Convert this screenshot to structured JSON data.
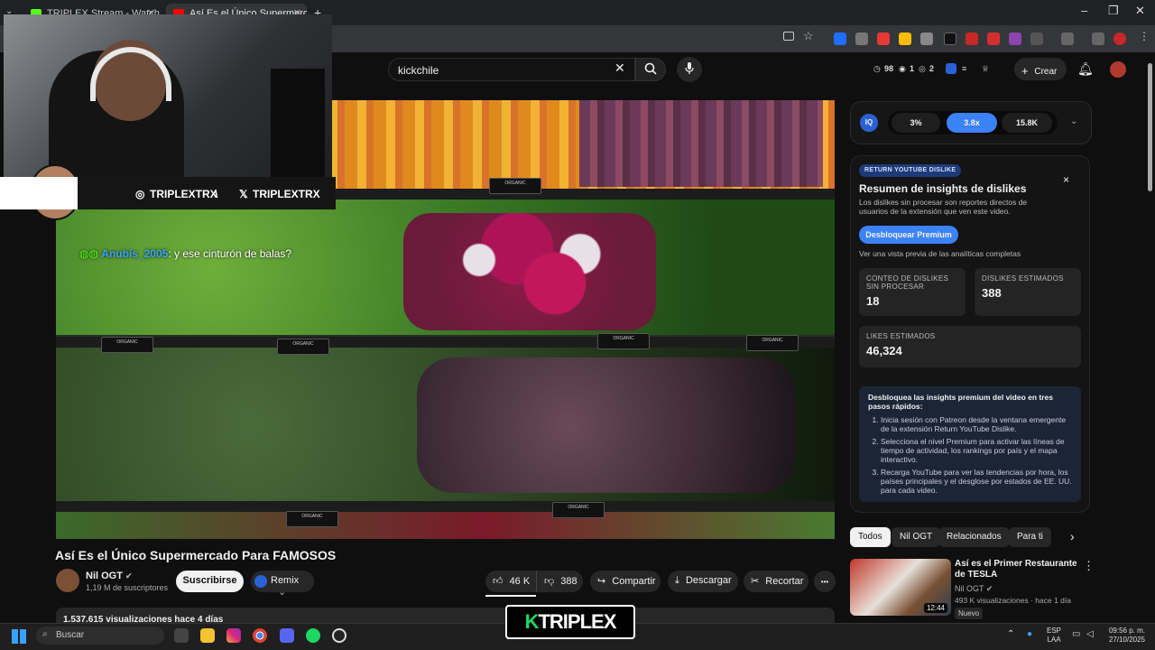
{
  "browser": {
    "tabs": [
      {
        "label": "TRIPLEX Stream - Watch Live o",
        "favicon_color": "#53fc18",
        "active": false
      },
      {
        "label": "Así Es el Único Supermercado P",
        "favicon_color": "#ff0000",
        "active": true
      }
    ],
    "new_tab": "+",
    "window_controls": [
      "–",
      "❐",
      "✕"
    ]
  },
  "header": {
    "search_value": "kickchile",
    "clear_icon": "close-icon",
    "search_icon": "search-icon",
    "mic_icon": "mic-icon",
    "stats": {
      "a": "98",
      "b": "1",
      "c": "2"
    },
    "create_label": "Crear",
    "create_plus": "+"
  },
  "overlay": {
    "instagram": "TRIPLEXTRX",
    "x_handle": "TRIPLEXTRX",
    "divider": "\\",
    "chat_user": "Anubis_2005",
    "chat_message": ": y ese cinturón de balas?"
  },
  "video": {
    "title": "Así Es el Único Supermercado Para FAMOSOS",
    "channel": "Nil OGT",
    "subscribers": "1,19 M de suscriptores",
    "subscribe_label": "Suscribirse",
    "remix_label": "Remix",
    "likes": "46 K",
    "dislikes": "388",
    "share_label": "Compartir",
    "download_label": "Descargar",
    "clip_label": "Recortar",
    "more_label": "•••",
    "description_stats": "1.537.615 visualizaciones  hace 4 días",
    "shelf_labels": [
      "ORGANIC",
      "ORGANIC",
      "ORGANIC",
      "ORGANIC",
      "ORGANIC",
      "ORGANIC",
      "ORGANIC"
    ]
  },
  "iq": {
    "logo": "IQ",
    "pills": [
      "3%",
      "3.8x",
      "15.8K"
    ]
  },
  "ryd": {
    "badge": "RETURN YOUTUBE DISLIKE",
    "title": "Resumen de insights de dislikes",
    "description": "Los dislikes sin procesar son reportes directos de usuarios de la extensión que ven este video.",
    "premium_button": "Desbloquear Premium",
    "preview_text": "Ver una vista previa de las analíticas completas",
    "cards": [
      {
        "key": "CONTEO DE DISLIKES SIN PROCESAR",
        "value": "18"
      },
      {
        "key": "DISLIKES ESTIMADOS",
        "value": "388"
      },
      {
        "key": "LIKES ESTIMADOS",
        "value": "46,324"
      }
    ],
    "steps_heading": "Desbloquea las insights premium del video en tres pasos rápidos:",
    "steps": [
      "Inicia sesión con Patreon desde la ventana emergente de la extensión Return YouTube Dislike.",
      "Selecciona el nivel Premium para activar las líneas de tiempo de actividad, los rankings por país y el mapa interactivo.",
      "Recarga YouTube para ver las tendencias por hora, los países principales y el desglose por estados de EE. UU. para cada video."
    ],
    "close_icon": "×"
  },
  "chips": [
    "Todos",
    "Nil OGT",
    "Relacionados",
    "Para ti"
  ],
  "recommendation": {
    "title": "Así es el Primer Restaurante de TESLA",
    "channel": "Nil OGT",
    "meta": "493 K visualizaciones · hace 1 día",
    "badge": "Nuevo",
    "duration": "12:44"
  },
  "taskbar": {
    "search_placeholder": "Buscar",
    "lang_top": "ESP",
    "lang_bottom": "LAA",
    "time": "09:56 p. m.",
    "date": "27/10/2025",
    "stream_logo": "TRIPLEX",
    "stream_logo_k": "K"
  }
}
